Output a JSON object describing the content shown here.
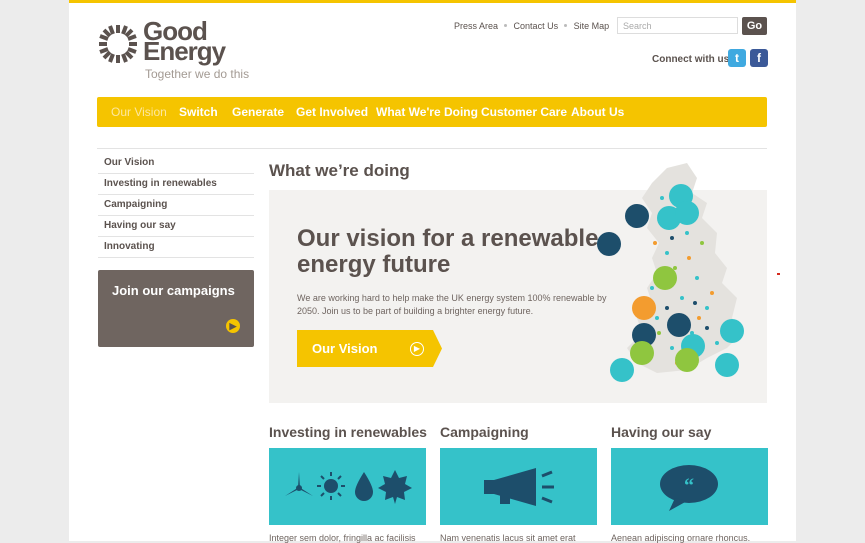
{
  "brand": {
    "name_line1": "Good",
    "name_line2": "Energy",
    "tagline": "Together we do this",
    "brand_color": "#f5c400",
    "text_color": "#5b524e",
    "accent_teal": "#35c2c9"
  },
  "header": {
    "links": [
      "Press Area",
      "Contact Us",
      "Site Map"
    ],
    "search_placeholder": "Search",
    "go_label": "Go",
    "connect_label": "Connect with us",
    "social": [
      {
        "icon": "twitter-icon",
        "glyph": "t"
      },
      {
        "icon": "facebook-icon",
        "glyph": "f"
      }
    ]
  },
  "nav": [
    "Our Vision",
    "Switch",
    "Generate",
    "Get Involved",
    "What We're Doing",
    "Customer Care",
    "About Us"
  ],
  "sidebar": {
    "items": [
      "Our Vision",
      "Investing in renewables",
      "Campaigning",
      "Having our say",
      "Innovating"
    ],
    "join_title": "Join our campaigns"
  },
  "main": {
    "page_title": "What we’re doing",
    "hero_title": "Our vision for a renewable energy future",
    "hero_text": "We are working hard to help make the UK energy system 100% renewable by 2050. Join us to be part of building a brighter energy future.",
    "cta_label": "Our Vision"
  },
  "columns": [
    {
      "title": "Investing in renewables",
      "text": "Integer sem dolor, fringilla ac facilisis",
      "icon": "renewables-icons"
    },
    {
      "title": "Campaigning",
      "text": "Nam venenatis lacus sit amet erat",
      "icon": "megaphone-icon"
    },
    {
      "title": "Having our say",
      "text": "Aenean adipiscing ornare rhoncus.",
      "icon": "speech-bubble-icon"
    }
  ]
}
